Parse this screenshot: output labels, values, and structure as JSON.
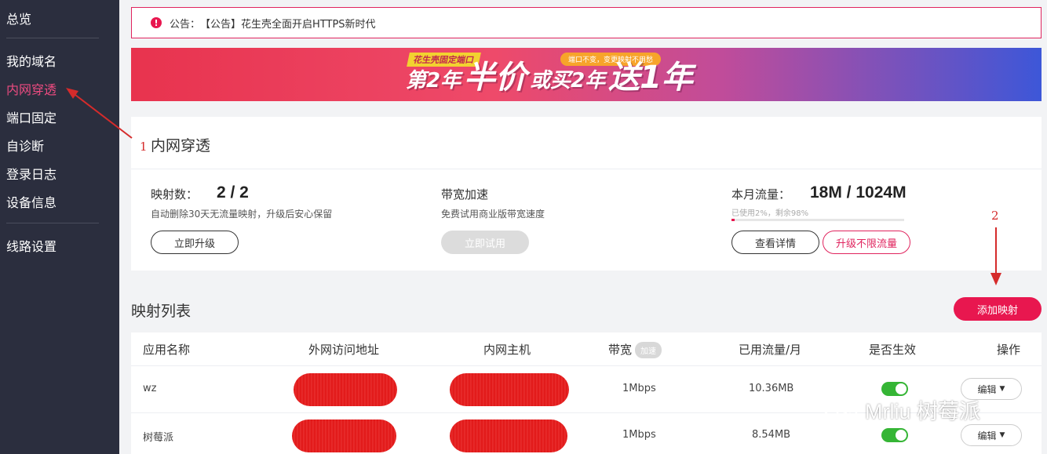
{
  "sidebar": {
    "items": [
      {
        "label": "总览"
      },
      {
        "label": "我的域名"
      },
      {
        "label": "内网穿透"
      },
      {
        "label": "端口固定"
      },
      {
        "label": "自诊断"
      },
      {
        "label": "登录日志"
      },
      {
        "label": "设备信息"
      },
      {
        "label": "线路设置"
      }
    ],
    "active_index": 2
  },
  "notice": {
    "icon": "exclamation-icon",
    "prefix": "公告：",
    "text": "【公告】花生壳全面开启HTTPS新时代"
  },
  "banner": {
    "tag": "花生壳固定端口",
    "pill": "端口不变，变更映射不用愁",
    "part1": "第2年",
    "part2": "半价",
    "part3": "或买2年",
    "part4": "送1年"
  },
  "tunnel": {
    "title": "内网穿透",
    "mapping": {
      "label": "映射数：",
      "value": "2 / 2",
      "desc": "自动删除30天无流量映射，升级后安心保留",
      "button": "立即升级"
    },
    "bandwidth": {
      "label": "带宽加速",
      "desc": "免费试用商业版带宽速度",
      "button": "立即试用"
    },
    "traffic": {
      "label": "本月流量：",
      "value": "18M / 1024M",
      "usage": "已使用2%，剩余98%",
      "progress": 0.02,
      "button_details": "查看详情",
      "button_upgrade": "升级不限流量"
    }
  },
  "mappings": {
    "title": "映射列表",
    "add_button": "添加映射",
    "columns": {
      "app": "应用名称",
      "external": "外网访问地址",
      "internal": "内网主机",
      "bandwidth": "带宽",
      "bandwidth_badge": "加速",
      "traffic": "已用流量/月",
      "enabled": "是否生效",
      "action": "操作"
    },
    "rows": [
      {
        "app": "wz",
        "bandwidth": "1Mbps",
        "traffic": "10.36MB",
        "enabled": true,
        "action": "编辑"
      },
      {
        "app": "树莓派",
        "bandwidth": "1Mbps",
        "traffic": "8.54MB",
        "enabled": true,
        "action": "编辑"
      }
    ]
  },
  "annotations": {
    "one": "1",
    "two": "2"
  },
  "watermark": {
    "text": "Mrliu 树莓派",
    "icon": "wechat-icon"
  },
  "colors": {
    "accent": "#e8174f",
    "sidebar": "#2b2e3e",
    "active": "#ec4b80",
    "toggle_on": "#35b535"
  }
}
